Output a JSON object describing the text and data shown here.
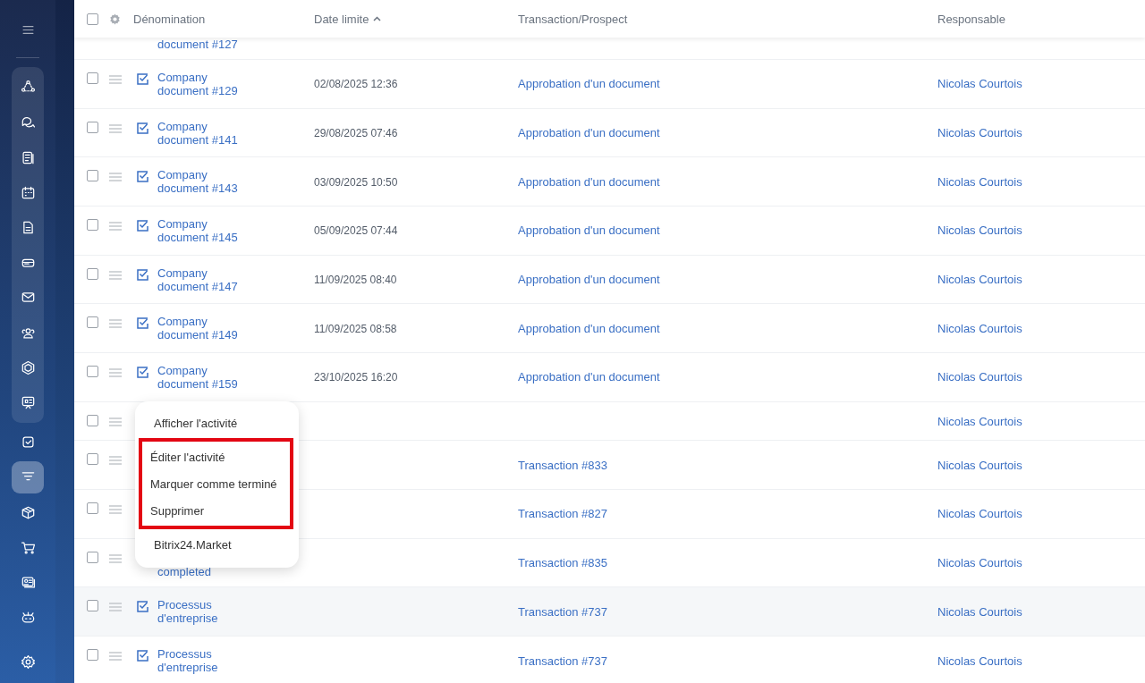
{
  "sidebar": {
    "top": [
      {
        "kind": "menu",
        "selected": false
      }
    ],
    "group": [
      {
        "kind": "nodes",
        "selected": false
      },
      {
        "kind": "chat",
        "selected": false
      },
      {
        "kind": "feed",
        "selected": false
      },
      {
        "kind": "calendar",
        "selected": false
      },
      {
        "kind": "document",
        "selected": false
      },
      {
        "kind": "drive",
        "selected": false
      },
      {
        "kind": "mail",
        "selected": false
      },
      {
        "kind": "people",
        "selected": false
      },
      {
        "kind": "hexagon",
        "selected": false
      },
      {
        "kind": "board",
        "selected": false
      }
    ],
    "items": [
      {
        "kind": "check",
        "selected": false
      },
      {
        "kind": "funnel",
        "selected": true
      },
      {
        "kind": "cube",
        "selected": false
      },
      {
        "kind": "cart",
        "selected": false
      },
      {
        "kind": "card",
        "selected": false
      },
      {
        "kind": "robot",
        "selected": false
      }
    ],
    "bottom": [
      {
        "kind": "gear",
        "selected": false
      }
    ]
  },
  "table": {
    "select_all": {
      "checked": false
    },
    "columns": [
      {
        "label": "Dénomination",
        "sorted": false
      },
      {
        "label": "Date limite",
        "sorted": true
      },
      {
        "label": "Transaction/Prospect",
        "sorted": false
      },
      {
        "label": "Responsable",
        "sorted": false
      }
    ],
    "rows": [
      {
        "kind": "partial",
        "name": "document #127",
        "date": "",
        "deal": "",
        "responsible": ""
      },
      {
        "kind": "task",
        "checked": false,
        "name": "Company document #129",
        "date": "02/08/2025 12:36",
        "deal": "Approbation d'un document",
        "responsible": "Nicolas Courtois"
      },
      {
        "kind": "task",
        "checked": false,
        "name": "Company document #141",
        "date": "29/08/2025 07:46",
        "deal": "Approbation d'un document",
        "responsible": "Nicolas Courtois"
      },
      {
        "kind": "task",
        "checked": false,
        "name": "Company document #143",
        "date": "03/09/2025 10:50",
        "deal": "Approbation d'un document",
        "responsible": "Nicolas Courtois"
      },
      {
        "kind": "task",
        "checked": false,
        "name": "Company document #145",
        "date": "05/09/2025 07:44",
        "deal": "Approbation d'un document",
        "responsible": "Nicolas Courtois"
      },
      {
        "kind": "task",
        "checked": false,
        "name": "Company document #147",
        "date": "11/09/2025 08:40",
        "deal": "Approbation d'un document",
        "responsible": "Nicolas Courtois"
      },
      {
        "kind": "task",
        "checked": false,
        "name": "Company document #149",
        "date": "11/09/2025 08:58",
        "deal": "Approbation d'un document",
        "responsible": "Nicolas Courtois"
      },
      {
        "kind": "task",
        "checked": false,
        "name": "Company document #159",
        "date": "23/10/2025 16:20",
        "deal": "Approbation d'un document",
        "responsible": "Nicolas Courtois"
      },
      {
        "kind": "short",
        "checked": false,
        "name": "",
        "date": "",
        "deal": "",
        "responsible": "Nicolas Courtois"
      },
      {
        "kind": "covered",
        "checked": false,
        "name": "",
        "date": "",
        "deal": "Transaction #833",
        "responsible": "Nicolas Courtois"
      },
      {
        "kind": "covered",
        "checked": false,
        "name": "",
        "date": "",
        "deal": "Transaction #827",
        "responsible": "Nicolas Courtois"
      },
      {
        "kind": "covered",
        "checked": false,
        "name": "completed",
        "date": "",
        "deal": "Transaction #835",
        "responsible": "Nicolas Courtois"
      },
      {
        "kind": "hovered",
        "checked": false,
        "name": "Processus d'entreprise",
        "date": "",
        "deal": "Transaction #737",
        "responsible": "Nicolas Courtois"
      },
      {
        "kind": "task",
        "checked": false,
        "name": "Processus d'entreprise",
        "date": "",
        "deal": "Transaction #737",
        "responsible": "Nicolas Courtois"
      }
    ]
  },
  "context_menu": {
    "items": [
      {
        "label": "Afficher l'activité",
        "highlighted": false
      },
      {
        "label": "Éditer l'activité",
        "highlighted": true
      },
      {
        "label": "Marquer comme terminé",
        "highlighted": true
      },
      {
        "label": "Supprimer",
        "highlighted": true
      },
      {
        "label": "Bitrix24.Market",
        "highlighted": false
      }
    ]
  }
}
